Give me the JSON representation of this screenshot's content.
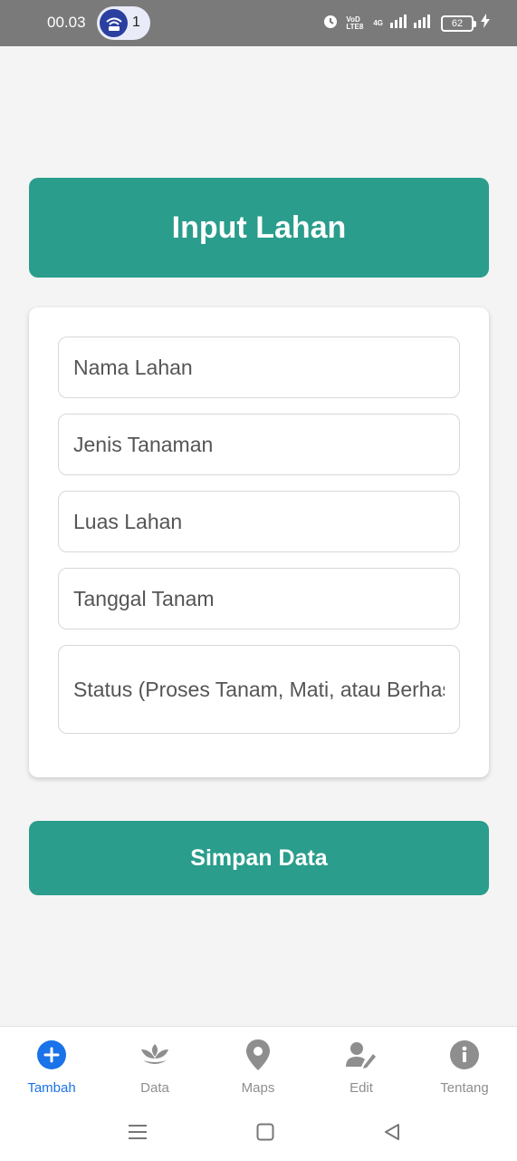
{
  "status_bar": {
    "time": "00.03",
    "hotspot_count": "1",
    "network_labels": [
      "VoD LTE8",
      "4G"
    ],
    "battery": "62",
    "icons": [
      "hotspot-icon",
      "alarm-icon",
      "signal-icon",
      "battery-icon",
      "charging-icon"
    ]
  },
  "header": {
    "title": "Input Lahan"
  },
  "form": {
    "fields": [
      {
        "placeholder": "Nama Lahan",
        "value": ""
      },
      {
        "placeholder": "Jenis Tanaman",
        "value": ""
      },
      {
        "placeholder": "Luas Lahan",
        "value": ""
      },
      {
        "placeholder": "Tanggal Tanam",
        "value": ""
      },
      {
        "placeholder": "Status (Proses Tanam, Mati, atau Berhasil)",
        "value": ""
      }
    ],
    "submit_label": "Simpan Data"
  },
  "bottom_nav": {
    "items": [
      {
        "label": "Tambah",
        "icon": "plus-circle-icon",
        "active": true
      },
      {
        "label": "Data",
        "icon": "plant-icon",
        "active": false
      },
      {
        "label": "Maps",
        "icon": "map-pin-icon",
        "active": false
      },
      {
        "label": "Edit",
        "icon": "user-edit-icon",
        "active": false
      },
      {
        "label": "Tentang",
        "icon": "info-icon",
        "active": false
      }
    ]
  },
  "colors": {
    "primary": "#2a9d8c",
    "active_nav": "#1a73e8",
    "status_bar": "#7a7a7a",
    "background": "#f4f4f4"
  }
}
